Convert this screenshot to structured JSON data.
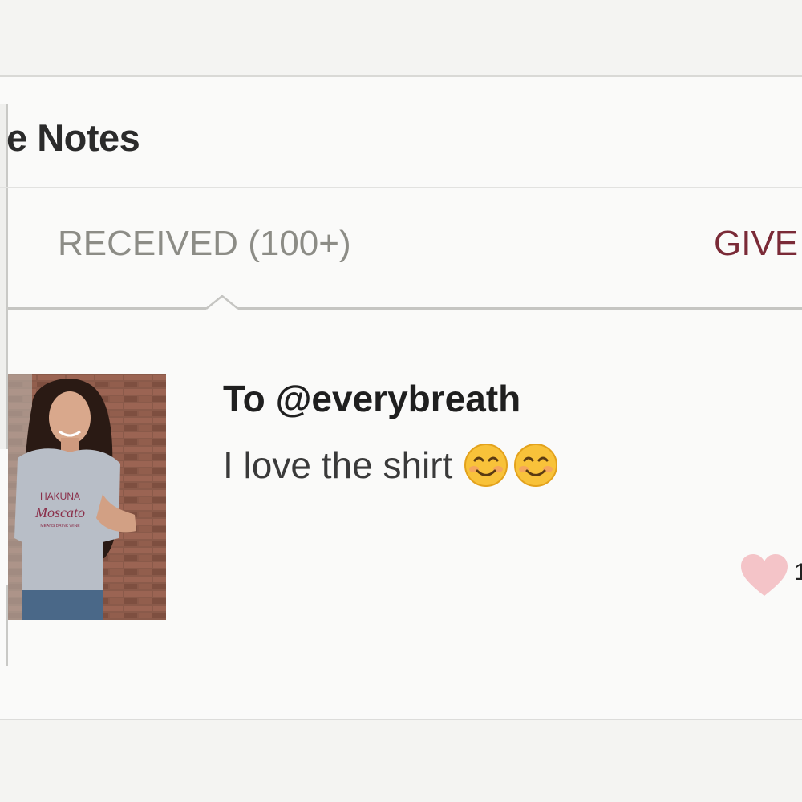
{
  "header": {
    "title": "e Notes"
  },
  "tabs": {
    "received": {
      "label": "RECEIVED",
      "count": "(100+)"
    },
    "given": {
      "label": "GIVE"
    }
  },
  "note": {
    "to": "To @everybreath",
    "text": "I love the shirt",
    "emojis": [
      "smiling-face-icon",
      "smiling-face-icon"
    ],
    "shirt_print": {
      "line1": "HAKUNA",
      "line2": "Moscato",
      "line3": "MEANS DRINK WINE"
    },
    "like_count": "1"
  },
  "colors": {
    "background": "#f4f4f2",
    "card": "#fafaf9",
    "tab_inactive": "#8c8c86",
    "tab_accent": "#7a2a37",
    "heart": "#f4c4c8",
    "text_dark": "#1f1f1f"
  }
}
